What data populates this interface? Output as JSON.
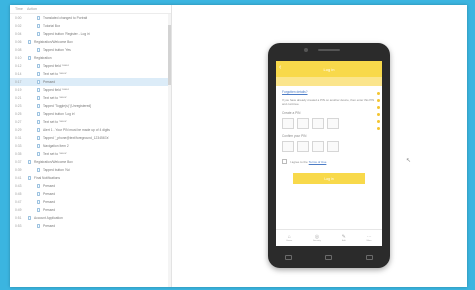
{
  "recording_panel": {
    "col_time": "Time",
    "col_action": "Action",
    "rows": [
      {
        "time": "0:00",
        "label": "Translated changed to Portrait",
        "level": 2
      },
      {
        "time": "0:02",
        "label": "Tutorial Box",
        "level": 2
      },
      {
        "time": "0:04",
        "label": "Tapped button 'Register - Log in'",
        "level": 2
      },
      {
        "time": "0:06",
        "label": "Registration/Welcome Box",
        "level": 1
      },
      {
        "time": "0:08",
        "label": "Tapped button 'Yes'",
        "level": 2
      },
      {
        "time": "0:10",
        "label": "Registration",
        "level": 1
      },
      {
        "time": "0:12",
        "label": "Tapped field '*****'",
        "level": 2
      },
      {
        "time": "0:14",
        "label": "Text set to '*****'",
        "level": 2
      },
      {
        "time": "0:17",
        "label": "Pressed",
        "level": 2,
        "selected": true
      },
      {
        "time": "0:19",
        "label": "Tapped field '*****'",
        "level": 2
      },
      {
        "time": "0:21",
        "label": "Text set to '*****'",
        "level": 2
      },
      {
        "time": "0:23",
        "label": "Tapped 'Toggle(s)' [Unregistered]",
        "level": 2
      },
      {
        "time": "0:25",
        "label": "Tapped button 'Log in'",
        "level": 2
      },
      {
        "time": "0:27",
        "label": "Text set to '*****'",
        "level": 2
      },
      {
        "time": "0:29",
        "label": "Alert 1 - Your PIN must be made up of 4 digits",
        "level": 2
      },
      {
        "time": "0:31",
        "label": "Tapped '_phone@text/foreground_1234567a'",
        "level": 2
      },
      {
        "time": "0:33",
        "label": "Navigation Item 2",
        "level": 2
      },
      {
        "time": "0:35",
        "label": "Text set to '*****'",
        "level": 2
      },
      {
        "time": "0:37",
        "label": "Registration/Welcome Box",
        "level": 1
      },
      {
        "time": "0:39",
        "label": "Tapped button 'No'",
        "level": 2
      },
      {
        "time": "0:41",
        "label": "Final Notifications",
        "level": 1
      },
      {
        "time": "0:43",
        "label": "Pressed",
        "level": 2
      },
      {
        "time": "0:45",
        "label": "Pressed",
        "level": 2
      },
      {
        "time": "0:47",
        "label": "Pressed",
        "level": 2
      },
      {
        "time": "0:49",
        "label": "Pressed",
        "level": 2
      },
      {
        "time": "0:51",
        "label": "Account Application",
        "level": 1
      },
      {
        "time": "0:53",
        "label": "Pressed",
        "level": 2
      }
    ]
  },
  "phone": {
    "app_bar_title": "Log in",
    "back_glyph": "‹",
    "forgot_link": "Forgotten details?",
    "instructions": "If you have already created a PIN on another device, then enter this PIN and continue.",
    "pin_label": "Create a PIN",
    "confirm_label": "Confirm your PIN",
    "agree_text": "I agree to the",
    "terms_link": "Terms of Use",
    "submit_label": "Log in",
    "nav": [
      {
        "icon": "home-icon",
        "glyph": "⌂",
        "label": "Home"
      },
      {
        "icon": "shield-icon",
        "glyph": "◎",
        "label": "Security"
      },
      {
        "icon": "pen-icon",
        "glyph": "✎",
        "label": "Edit"
      },
      {
        "icon": "more-icon",
        "glyph": "⋯",
        "label": "More"
      }
    ]
  },
  "colors": {
    "background": "#3bb5e0",
    "accent_yellow": "#f8d94b",
    "link_blue": "#4c7cc6",
    "selected_row": "#dcecf8"
  }
}
